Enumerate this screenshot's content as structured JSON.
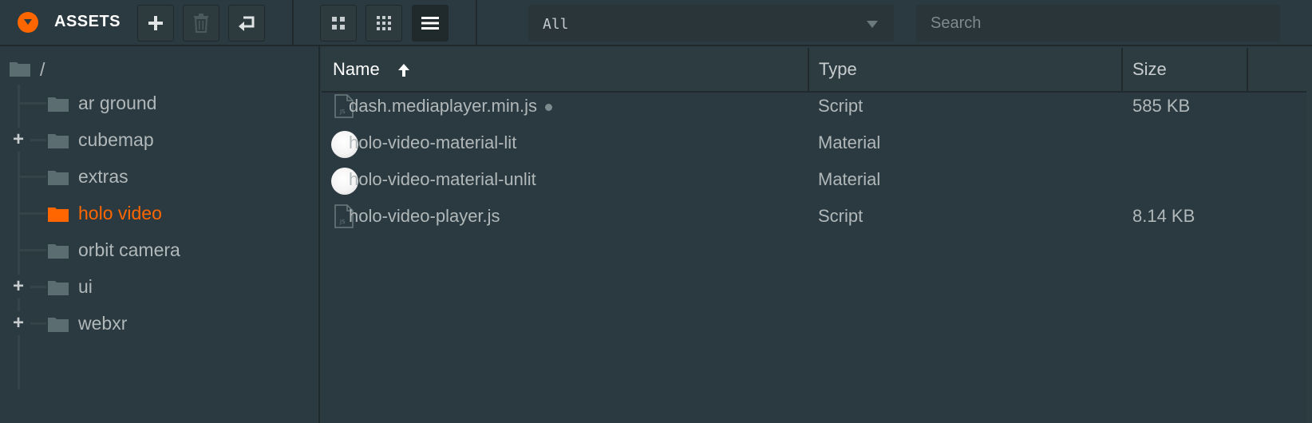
{
  "header": {
    "title": "ASSETS",
    "filter": {
      "selected": "All"
    },
    "search": {
      "placeholder": "Search",
      "value": ""
    }
  },
  "tree": {
    "root_label": "/",
    "items": [
      {
        "label": "ar ground",
        "expandable": false,
        "selected": false
      },
      {
        "label": "cubemap",
        "expandable": true,
        "selected": false
      },
      {
        "label": "extras",
        "expandable": false,
        "selected": false
      },
      {
        "label": "holo video",
        "expandable": false,
        "selected": true
      },
      {
        "label": "orbit camera",
        "expandable": false,
        "selected": false
      },
      {
        "label": "ui",
        "expandable": true,
        "selected": false
      },
      {
        "label": "webxr",
        "expandable": true,
        "selected": false
      }
    ],
    "expander_glyph": "+"
  },
  "table": {
    "columns": {
      "name": "Name",
      "type": "Type",
      "size": "Size"
    },
    "sort": {
      "column": "name",
      "direction": "ascending"
    },
    "rows": [
      {
        "icon": "script-file-icon",
        "name": "dash.mediaplayer.min.js",
        "type": "Script",
        "size": "585 KB",
        "modified": true
      },
      {
        "icon": "material-icon",
        "name": "holo-video-material-lit",
        "type": "Material",
        "size": ""
      },
      {
        "icon": "material-icon",
        "name": "holo-video-material-unlit",
        "type": "Material",
        "size": ""
      },
      {
        "icon": "script-file-icon",
        "name": "holo-video-player.js",
        "type": "Script",
        "size": "8.14 KB"
      }
    ]
  },
  "colors": {
    "accent": "#ff6600",
    "background": "#2a3a40",
    "text": "#b1b8ba",
    "header_text": "#ffffff"
  }
}
